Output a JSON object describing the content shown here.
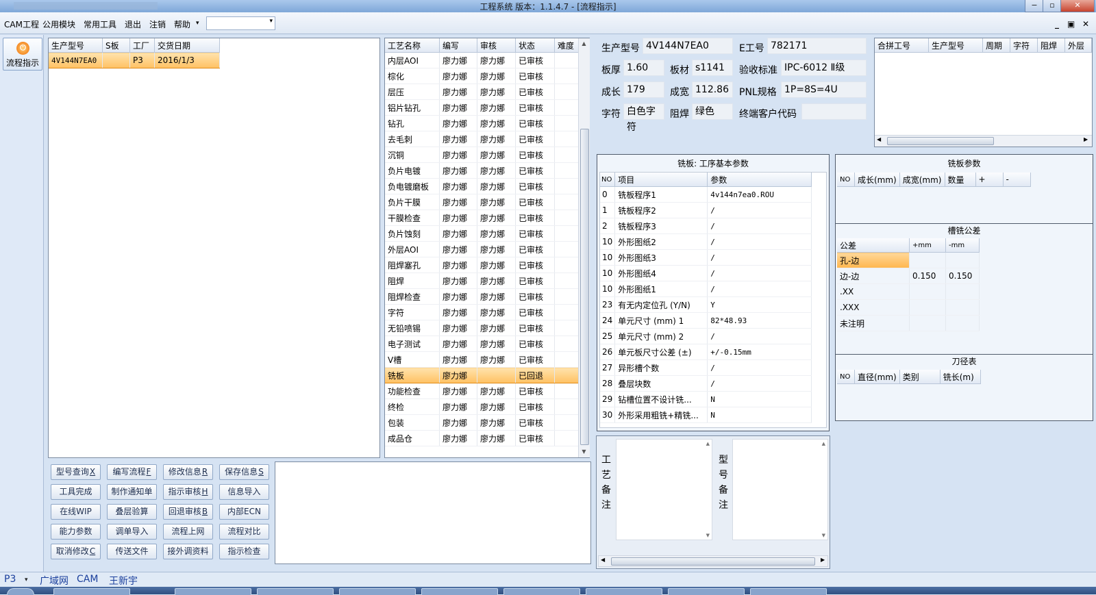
{
  "window": {
    "title": "工程系统  版本：1.1.4.7 - [流程指示]",
    "buttons": [
      "0",
      "1",
      "r"
    ]
  },
  "menu": {
    "items": [
      "CAM工程",
      "公用模块",
      "常用工具",
      "退出",
      "注销",
      "帮助"
    ],
    "help_arrow": "▾",
    "combo_value": "",
    "combo_arrow": "▾",
    "mdi_buttons": [
      "_",
      "▣",
      "✕"
    ]
  },
  "side": {
    "flow_label": "流程指示",
    "flow_icon": "⏻"
  },
  "order_list": {
    "headers": [
      "生产型号",
      "S板",
      "工厂",
      "交货日期"
    ],
    "rows": [
      [
        "4V144N7EA0",
        "",
        "P3",
        "2016/1/3"
      ]
    ]
  },
  "process_list": {
    "headers": [
      "工艺名称",
      "编写",
      "审核",
      "状态",
      "难度"
    ],
    "rows": [
      [
        "内层AOI",
        "廖力娜",
        "廖力娜",
        "已审核",
        ""
      ],
      [
        "棕化",
        "廖力娜",
        "廖力娜",
        "已审核",
        ""
      ],
      [
        "层压",
        "廖力娜",
        "廖力娜",
        "已审核",
        ""
      ],
      [
        "铝片钻孔",
        "廖力娜",
        "廖力娜",
        "已审核",
        ""
      ],
      [
        "钻孔",
        "廖力娜",
        "廖力娜",
        "已审核",
        ""
      ],
      [
        "去毛刺",
        "廖力娜",
        "廖力娜",
        "已审核",
        ""
      ],
      [
        "沉铜",
        "廖力娜",
        "廖力娜",
        "已审核",
        ""
      ],
      [
        "负片电镀",
        "廖力娜",
        "廖力娜",
        "已审核",
        ""
      ],
      [
        "负电镀磨板",
        "廖力娜",
        "廖力娜",
        "已审核",
        ""
      ],
      [
        "负片干膜",
        "廖力娜",
        "廖力娜",
        "已审核",
        ""
      ],
      [
        "干膜检查",
        "廖力娜",
        "廖力娜",
        "已审核",
        ""
      ],
      [
        "负片蚀刻",
        "廖力娜",
        "廖力娜",
        "已审核",
        ""
      ],
      [
        "外层AOI",
        "廖力娜",
        "廖力娜",
        "已审核",
        ""
      ],
      [
        "阻焊塞孔",
        "廖力娜",
        "廖力娜",
        "已审核",
        ""
      ],
      [
        "阻焊",
        "廖力娜",
        "廖力娜",
        "已审核",
        ""
      ],
      [
        "阻焊检查",
        "廖力娜",
        "廖力娜",
        "已审核",
        ""
      ],
      [
        "字符",
        "廖力娜",
        "廖力娜",
        "已审核",
        ""
      ],
      [
        "无铅喷锡",
        "廖力娜",
        "廖力娜",
        "已审核",
        ""
      ],
      [
        "电子测试",
        "廖力娜",
        "廖力娜",
        "已审核",
        ""
      ],
      [
        "V槽",
        "廖力娜",
        "廖力娜",
        "已审核",
        ""
      ],
      [
        "铣板",
        "廖力娜",
        "",
        "已回退",
        ""
      ],
      [
        "功能检查",
        "廖力娜",
        "廖力娜",
        "已审核",
        ""
      ],
      [
        "终检",
        "廖力娜",
        "廖力娜",
        "已审核",
        ""
      ],
      [
        "包装",
        "廖力娜",
        "廖力娜",
        "已审核",
        ""
      ],
      [
        "成品仓",
        "廖力娜",
        "廖力娜",
        "已审核",
        ""
      ]
    ],
    "selected_index": 20
  },
  "info": {
    "model_label": "生产型号",
    "model": "4V144N7EA0",
    "e_label": "E工号",
    "e_no": "782171",
    "thick_label": "板厚",
    "thick": "1.60",
    "mat_label": "板材",
    "mat": "s1141",
    "std_label": "验收标准",
    "std": "IPC-6012 Ⅱ级",
    "len_label": "成长",
    "len": "179",
    "wid_label": "成宽",
    "wid": "112.86",
    "pnl_label": "PNL规格",
    "pnl": "1P=8S=4U",
    "char_label": "字符",
    "char": "白色字符",
    "mask_label": "阻焊",
    "mask": "绿色",
    "cust_label": "终端客户代码",
    "cust": ""
  },
  "combine": {
    "headers": [
      "合拼工号",
      "生产型号",
      "周期",
      "字符",
      "阻焊",
      "外层"
    ]
  },
  "mill_params": {
    "title": "铣板: 工序基本参数",
    "headers": [
      "NO",
      "项目",
      "参数"
    ],
    "rows": [
      [
        "0",
        "铣板程序1",
        "4v144n7ea0.ROU"
      ],
      [
        "1",
        "铣板程序2",
        "/"
      ],
      [
        "2",
        "铣板程序3",
        "/"
      ],
      [
        "10",
        "外形图纸2",
        "/"
      ],
      [
        "10",
        "外形图纸3",
        "/"
      ],
      [
        "10",
        "外形图纸4",
        "/"
      ],
      [
        "10",
        "外形图纸1",
        "/"
      ],
      [
        "23",
        "有无内定位孔 (Y/N)",
        "Y"
      ],
      [
        "24",
        "单元尺寸 (mm) 1",
        "82*48.93"
      ],
      [
        "25",
        "单元尺寸 (mm) 2",
        "/"
      ],
      [
        "26",
        "单元板尺寸公差 (±)",
        "+/-0.15mm"
      ],
      [
        "27",
        "异形槽个数",
        "/"
      ],
      [
        "28",
        "叠层块数",
        "/"
      ],
      [
        "29",
        "钻槽位置不设计铣...",
        "N"
      ],
      [
        "30",
        "外形采用粗铣+精铣...",
        "N"
      ]
    ]
  },
  "mill_board": {
    "title": "铣板参数",
    "headers": [
      "NO",
      "成长(mm)",
      "成宽(mm)",
      "数量",
      "+",
      "-"
    ]
  },
  "slot_tol": {
    "title": "槽铣公差",
    "headers": [
      "公差",
      "+mm",
      "-mm"
    ],
    "rows": [
      [
        "孔-边",
        "",
        ""
      ],
      [
        "边-边",
        "0.150",
        "0.150"
      ],
      [
        ".XX",
        "",
        ""
      ],
      [
        ".XXX",
        "",
        ""
      ],
      [
        "未注明",
        "",
        ""
      ]
    ]
  },
  "tool_table": {
    "title": "刀径表",
    "headers": [
      "NO",
      "直径(mm)",
      "类别",
      "铣长(m)"
    ]
  },
  "remarks": {
    "process_label": "工艺备注",
    "model_label": "型号备注",
    "process_text": "",
    "model_text": ""
  },
  "buttons": [
    {
      "text": "型号查询",
      "key": "X"
    },
    {
      "text": "编写流程",
      "key": "F"
    },
    {
      "text": "修改信息",
      "key": "R"
    },
    {
      "text": "保存信息",
      "key": "S"
    },
    {
      "text": "工具完成",
      "key": ""
    },
    {
      "text": "制作通知单",
      "key": ""
    },
    {
      "text": "指示审核",
      "key": "H"
    },
    {
      "text": "信息导入",
      "key": ""
    },
    {
      "text": "在线WIP",
      "key": ""
    },
    {
      "text": "叠层验算",
      "key": ""
    },
    {
      "text": "回退审核",
      "key": "B"
    },
    {
      "text": "内部ECN",
      "key": ""
    },
    {
      "text": "能力参数",
      "key": ""
    },
    {
      "text": "调单导入",
      "key": ""
    },
    {
      "text": "流程上网",
      "key": ""
    },
    {
      "text": "流程对比",
      "key": ""
    },
    {
      "text": "取消修改",
      "key": "C"
    },
    {
      "text": "传送文件",
      "key": ""
    },
    {
      "text": "接外调资料",
      "key": ""
    },
    {
      "text": "指示检查",
      "key": ""
    }
  ],
  "status": {
    "factory": "P3",
    "arrow": "▾",
    "items": [
      "广域网",
      "CAM",
      "王新宇"
    ]
  }
}
